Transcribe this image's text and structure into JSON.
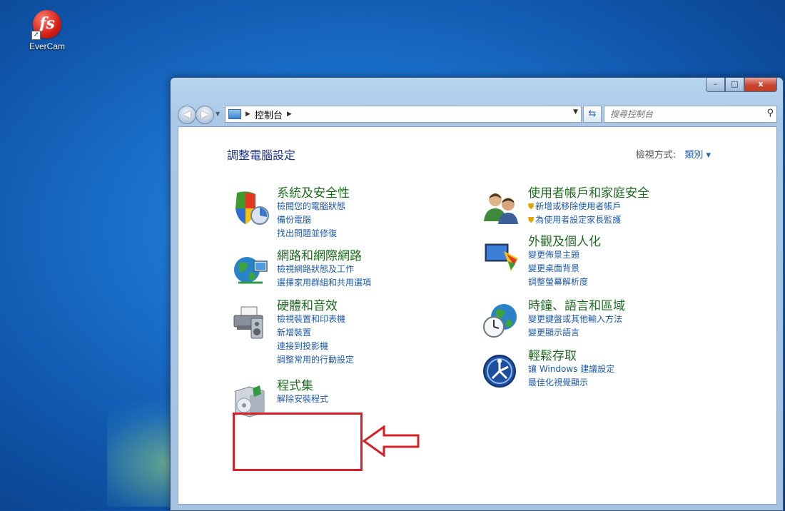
{
  "desktop": {
    "icon_label": "EverCam",
    "icon_glyph": "fs"
  },
  "window": {
    "controls": {
      "minimize": "–",
      "maximize": "□",
      "close": "x"
    },
    "address": {
      "crumbs": [
        "控制台"
      ]
    },
    "search": {
      "placeholder": "搜尋控制台"
    }
  },
  "header": {
    "title": "調整電腦設定",
    "view_by_label": "檢視方式:",
    "view_by_value": "類別 ▾"
  },
  "categories": [
    {
      "title": "系統及安全性",
      "icon": "shield-icon",
      "links": [
        "檢閱您的電腦狀態",
        "備份電腦",
        "找出問題並修復"
      ]
    },
    {
      "title": "網路和網際網路",
      "icon": "network-globe-icon",
      "links": [
        "檢視網路狀態及工作",
        "選擇家用群組和共用選項"
      ]
    },
    {
      "title": "硬體和音效",
      "icon": "printer-speaker-icon",
      "links": [
        "檢視裝置和印表機",
        "新增裝置",
        "連接到投影機",
        "調整常用的行動設定"
      ]
    },
    {
      "title": "程式集",
      "icon": "programs-box-icon",
      "links": [
        "解除安裝程式"
      ]
    },
    {
      "title": "使用者帳戶和家庭安全",
      "icon": "users-icon",
      "links": [
        "新增或移除使用者帳戶",
        "為使用者設定家長監護"
      ]
    },
    {
      "title": "外觀及個人化",
      "icon": "monitor-palette-icon",
      "links": [
        "變更佈景主題",
        "變更桌面背景",
        "調整螢幕解析度"
      ]
    },
    {
      "title": "時鐘、語言和區域",
      "icon": "globe-clock-icon",
      "links": [
        "變更鍵盤或其他輸入方法",
        "變更顯示語言"
      ]
    },
    {
      "title": "輕鬆存取",
      "icon": "ease-of-access-icon",
      "links": [
        "讓 Windows 建議設定",
        "最佳化視覺顯示"
      ]
    }
  ],
  "colors": {
    "category_title": "#1e6a21",
    "link": "#1e5aa8",
    "page_title": "#1e3287",
    "highlight": "#d72027"
  }
}
